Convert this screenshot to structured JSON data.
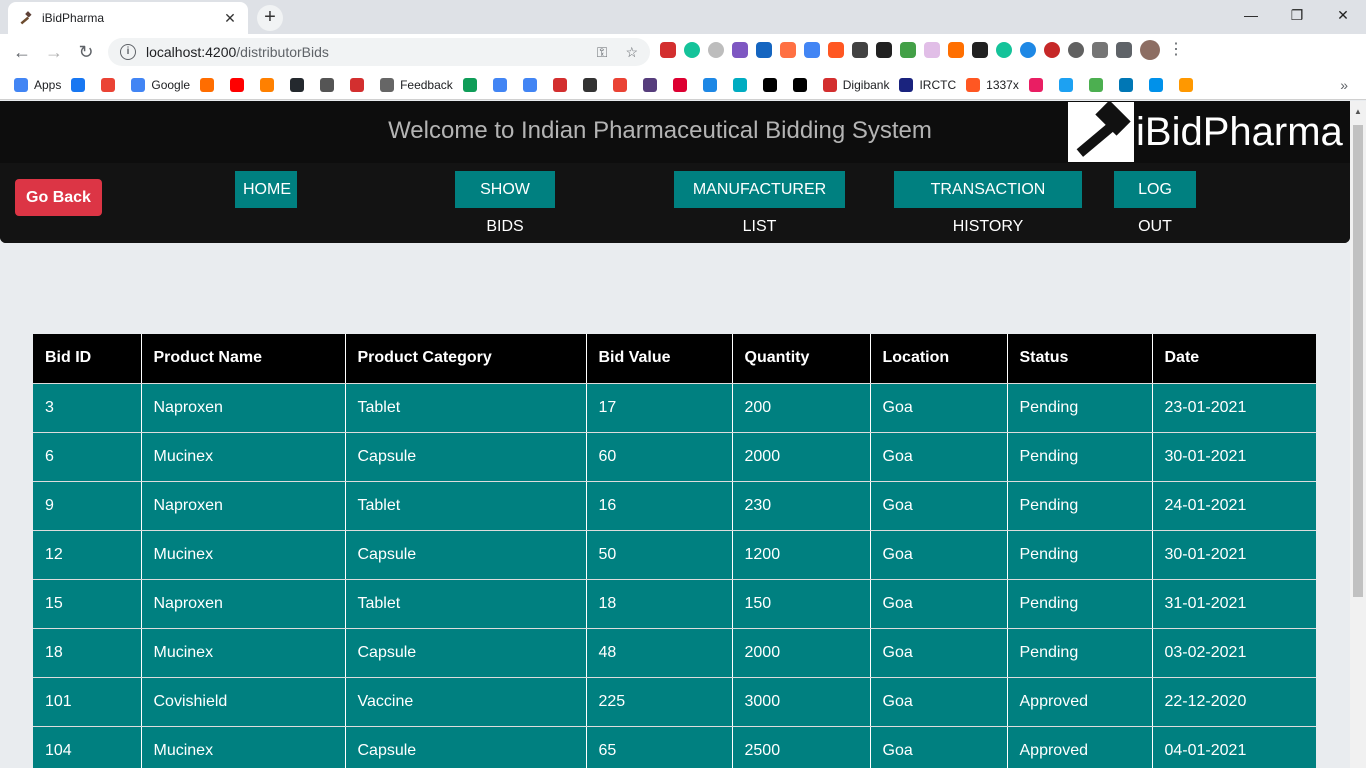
{
  "browser": {
    "tab_title": "iBidPharma",
    "url_host": "localhost:4200",
    "url_path": "/distributorBids",
    "bookmarks": [
      {
        "label": "Apps",
        "color": "#4285f4"
      },
      {
        "label": "",
        "color": "#1877f2"
      },
      {
        "label": "",
        "color": "#ea4335"
      },
      {
        "label": "Google",
        "color": "#4285f4"
      },
      {
        "label": "",
        "color": "#ff6d00"
      },
      {
        "label": "",
        "color": "#ff0000"
      },
      {
        "label": "",
        "color": "#ff8000"
      },
      {
        "label": "",
        "color": "#24292e"
      },
      {
        "label": "",
        "color": "#555555"
      },
      {
        "label": "",
        "color": "#d32f2f"
      },
      {
        "label": "Feedback",
        "color": "#666666"
      },
      {
        "label": "",
        "color": "#0f9d58"
      },
      {
        "label": "",
        "color": "#4285f4"
      },
      {
        "label": "",
        "color": "#4285f4"
      },
      {
        "label": "",
        "color": "#d32f2f"
      },
      {
        "label": "",
        "color": "#333333"
      },
      {
        "label": "",
        "color": "#ea4335"
      },
      {
        "label": "",
        "color": "#563d7c"
      },
      {
        "label": "",
        "color": "#dd0031"
      },
      {
        "label": "",
        "color": "#1e88e5"
      },
      {
        "label": "",
        "color": "#00acc1"
      },
      {
        "label": "",
        "color": "#000000"
      },
      {
        "label": "",
        "color": "#000000"
      },
      {
        "label": "Digibank",
        "color": "#d32f2f"
      },
      {
        "label": "IRCTC",
        "color": "#1a237e"
      },
      {
        "label": "1337x",
        "color": "#ff5722"
      },
      {
        "label": "",
        "color": "#e91e63"
      },
      {
        "label": "",
        "color": "#1da1f2"
      },
      {
        "label": "",
        "color": "#4caf50"
      },
      {
        "label": "",
        "color": "#0077b5"
      },
      {
        "label": "",
        "color": "#0091ea"
      },
      {
        "label": "",
        "color": "#ff9800"
      }
    ]
  },
  "header": {
    "welcome": "Welcome to Indian Pharmaceutical Bidding System",
    "logo_text": "iBidPharma"
  },
  "nav": {
    "go_back": "Go Back",
    "home": "HOME",
    "show_bids": "SHOW BIDS",
    "manufacturer_list": "MANUFACTURER LIST",
    "transaction_history": "TRANSACTION HISTORY",
    "log_out": "LOG OUT"
  },
  "table": {
    "headers": [
      "Bid ID",
      "Product Name",
      "Product Category",
      "Bid Value",
      "Quantity",
      "Location",
      "Status",
      "Date"
    ],
    "rows": [
      [
        "3",
        "Naproxen",
        "Tablet",
        "17",
        "200",
        "Goa",
        "Pending",
        "23-01-2021"
      ],
      [
        "6",
        "Mucinex",
        "Capsule",
        "60",
        "2000",
        "Goa",
        "Pending",
        "30-01-2021"
      ],
      [
        "9",
        "Naproxen",
        "Tablet",
        "16",
        "230",
        "Goa",
        "Pending",
        "24-01-2021"
      ],
      [
        "12",
        "Mucinex",
        "Capsule",
        "50",
        "1200",
        "Goa",
        "Pending",
        "30-01-2021"
      ],
      [
        "15",
        "Naproxen",
        "Tablet",
        "18",
        "150",
        "Goa",
        "Pending",
        "31-01-2021"
      ],
      [
        "18",
        "Mucinex",
        "Capsule",
        "48",
        "2000",
        "Goa",
        "Pending",
        "03-02-2021"
      ],
      [
        "101",
        "Covishield",
        "Vaccine",
        "225",
        "3000",
        "Goa",
        "Approved",
        "22-12-2020"
      ],
      [
        "104",
        "Mucinex",
        "Capsule",
        "65",
        "2500",
        "Goa",
        "Approved",
        "04-01-2021"
      ]
    ]
  },
  "colors": {
    "teal": "#008080",
    "danger": "#dc3545",
    "header_bg": "#0d0d0d"
  }
}
